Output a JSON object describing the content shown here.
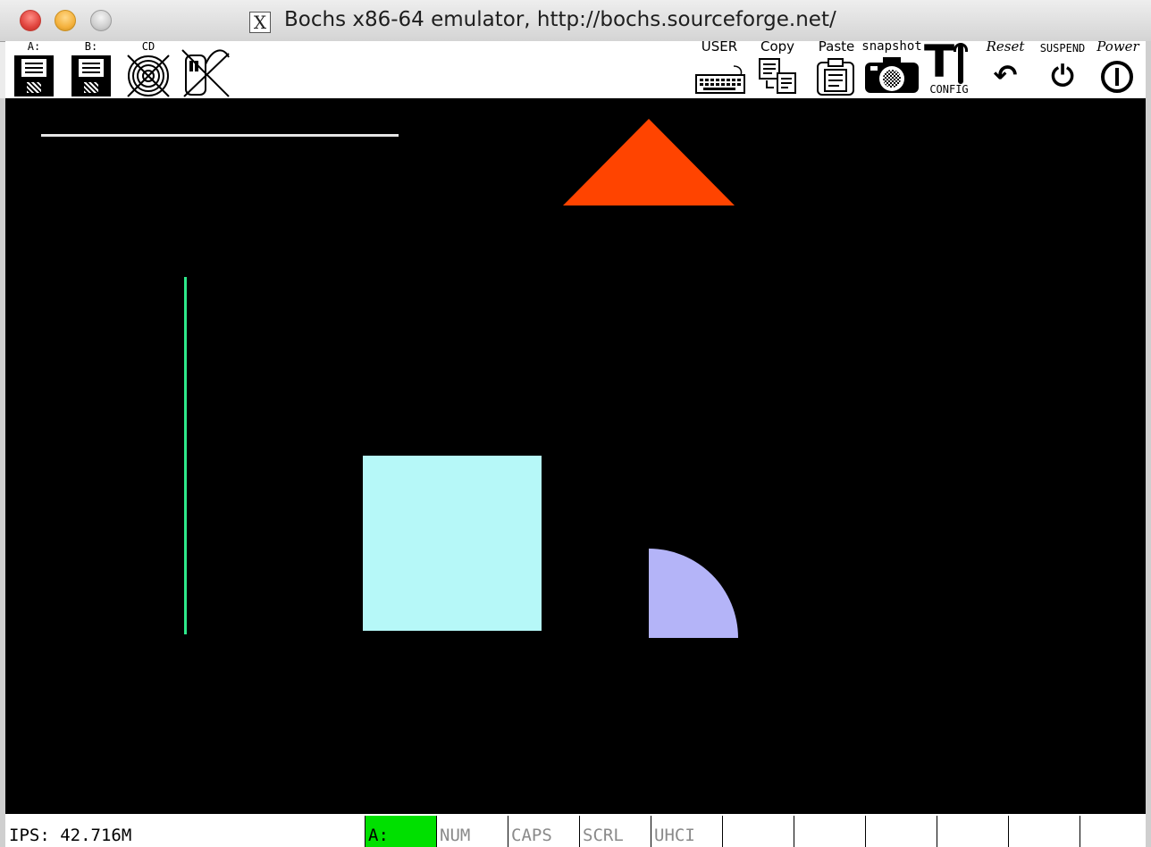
{
  "window": {
    "title": "Bochs x86-64 emulator, http://bochs.sourceforge.net/",
    "x_glyph": "X"
  },
  "toolbar": {
    "floppy_a_label": "A:",
    "floppy_b_label": "B:",
    "cdrom_label": "CD",
    "user_label": "USER",
    "copy_label": "Copy",
    "paste_label": "Paste",
    "snapshot_label": "snapshot",
    "config_label": "CONFIG",
    "reset_label": "Reset",
    "suspend_label": "SUSPEND",
    "power_label": "Power",
    "config_glyph": "T",
    "reset_glyph": "↶",
    "suspend_glyph": "⏻",
    "power_glyph": "⏼"
  },
  "screen": {
    "background": "#000000",
    "shapes": [
      {
        "name": "white-horizontal-line",
        "color": "#e6e6e6"
      },
      {
        "name": "orange-triangle",
        "color": "#ff4400"
      },
      {
        "name": "green-vertical-line",
        "color": "#2de88a"
      },
      {
        "name": "cyan-square",
        "color": "#b6f8f8"
      },
      {
        "name": "lavender-quarter-circle",
        "color": "#b4b4f8"
      }
    ]
  },
  "statusbar": {
    "ips": "IPS: 42.716M",
    "indicators": [
      {
        "label": "A:",
        "active": true
      },
      {
        "label": "NUM",
        "active": false
      },
      {
        "label": "CAPS",
        "active": false
      },
      {
        "label": "SCRL",
        "active": false
      },
      {
        "label": "UHCI",
        "active": false
      },
      {
        "label": "",
        "active": false
      },
      {
        "label": "",
        "active": false
      },
      {
        "label": "",
        "active": false
      },
      {
        "label": "",
        "active": false
      },
      {
        "label": "",
        "active": false
      },
      {
        "label": "",
        "active": false
      }
    ],
    "active_color": "#00e000"
  }
}
